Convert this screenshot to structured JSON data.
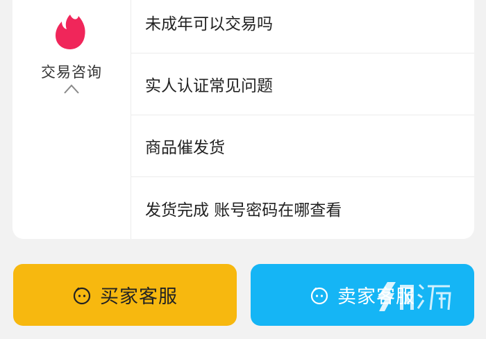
{
  "consult": {
    "category_label": "交易咨询",
    "icon": "flame-icon",
    "toggle_icon": "chevron-up-icon",
    "accent_color": "#f0265a"
  },
  "faq": {
    "items": [
      {
        "label": "未成年可以交易吗"
      },
      {
        "label": "实人认证常见问题"
      },
      {
        "label": "商品催发货"
      },
      {
        "label": "发货完成 账号密码在哪查看"
      }
    ]
  },
  "actions": {
    "buyer_label": "买家客服",
    "seller_label": "卖家客服",
    "buyer_color": "#f7b80f",
    "seller_color": "#15b5f5",
    "icon": "customer-service-icon"
  },
  "watermark": {
    "logo": "brand-logo-watermark"
  }
}
